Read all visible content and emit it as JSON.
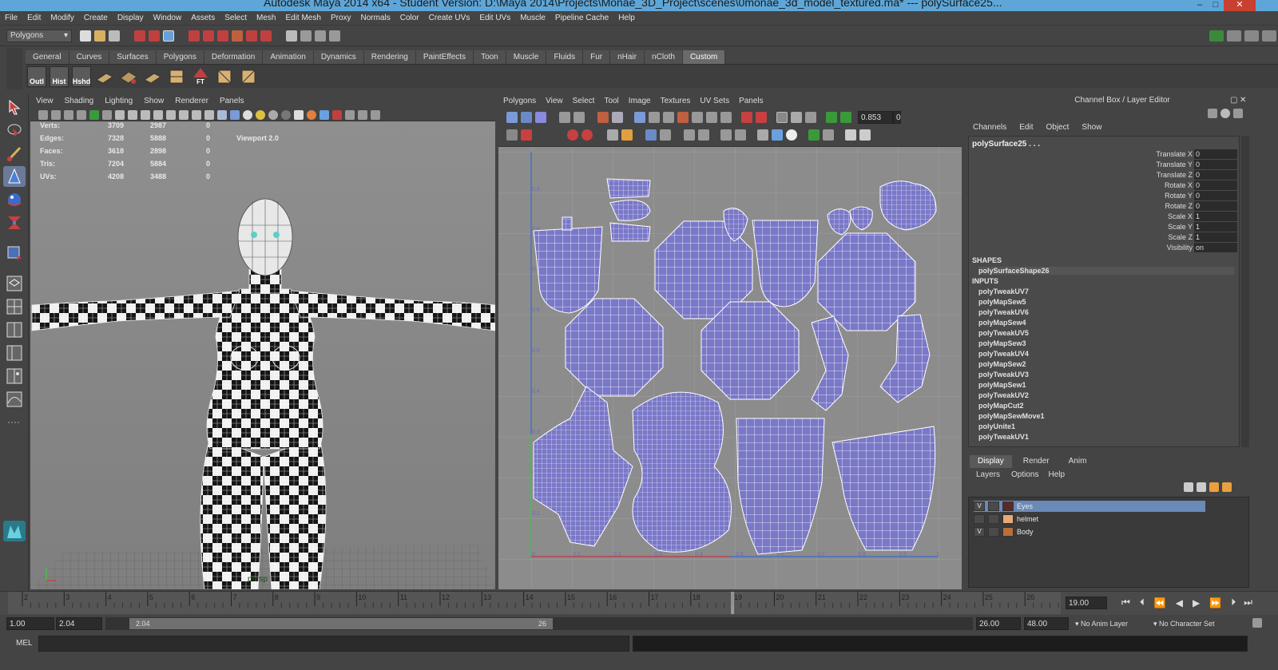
{
  "title": "Autodesk Maya 2014 x64 - Student Version: D:\\Maya 2014\\Projects\\Monae_3D_Project\\scenes\\0monae_3d_model_textured.ma*   ---   polySurface25...",
  "menu": [
    "File",
    "Edit",
    "Modify",
    "Create",
    "Display",
    "Window",
    "Assets",
    "Select",
    "Mesh",
    "Edit Mesh",
    "Proxy",
    "Normals",
    "Color",
    "Create UVs",
    "Edit UVs",
    "Muscle",
    "Pipeline Cache",
    "Help"
  ],
  "mode_selector": "Polygons",
  "shelf_tabs": [
    "General",
    "Curves",
    "Surfaces",
    "Polygons",
    "Deformation",
    "Animation",
    "Dynamics",
    "Rendering",
    "PaintEffects",
    "Toon",
    "Muscle",
    "Fluids",
    "Fur",
    "nHair",
    "nCloth",
    "Custom"
  ],
  "shelf_active": "Custom",
  "shelf_buttons": [
    "Outl",
    "Hist",
    "Hshd"
  ],
  "shelf_ft": "FT",
  "viewport_menu": [
    "View",
    "Shading",
    "Lighting",
    "Show",
    "Renderer",
    "Panels"
  ],
  "hud": {
    "rows": [
      {
        "label": "Verts:",
        "a": "3709",
        "b": "2987",
        "c": "0"
      },
      {
        "label": "Edges:",
        "a": "7328",
        "b": "5888",
        "c": "0"
      },
      {
        "label": "Faces:",
        "a": "3618",
        "b": "2898",
        "c": "0"
      },
      {
        "label": "Tris:",
        "a": "7204",
        "b": "5884",
        "c": "0"
      },
      {
        "label": "UVs:",
        "a": "4208",
        "b": "3488",
        "c": "0"
      }
    ],
    "renderer": "Viewport 2.0",
    "camera": "persp"
  },
  "uv_menu": [
    "Polygons",
    "View",
    "Select",
    "Tool",
    "Image",
    "Textures",
    "UV Sets",
    "Panels"
  ],
  "uv_field": "0.853",
  "uv_field2": "0",
  "uv_axis_labels": {
    "y": [
      "0.9",
      "0.8",
      "0.7",
      "0.6",
      "0.5",
      "0.4",
      "0.3",
      "0.2",
      "0.1"
    ],
    "x": [
      "0",
      "0.1",
      "0.2",
      "0.3",
      "0.4",
      "0.5",
      "0.6",
      "0.7",
      "0.8",
      "0.9",
      "1"
    ]
  },
  "channel_box": {
    "title": "Channel Box / Layer Editor",
    "menu": [
      "Channels",
      "Edit",
      "Object",
      "Show"
    ],
    "object": "polySurface25 . . .",
    "attrs": [
      {
        "name": "Translate X",
        "value": "0"
      },
      {
        "name": "Translate Y",
        "value": "0"
      },
      {
        "name": "Translate Z",
        "value": "0"
      },
      {
        "name": "Rotate X",
        "value": "0"
      },
      {
        "name": "Rotate Y",
        "value": "0"
      },
      {
        "name": "Rotate Z",
        "value": "0"
      },
      {
        "name": "Scale X",
        "value": "1"
      },
      {
        "name": "Scale Y",
        "value": "1"
      },
      {
        "name": "Scale Z",
        "value": "1"
      },
      {
        "name": "Visibility",
        "value": "on"
      }
    ],
    "shapes_label": "SHAPES",
    "shape": "polySurfaceShape26",
    "inputs_label": "INPUTS",
    "inputs": [
      "polyTweakUV7",
      "polyMapSew5",
      "polyTweakUV6",
      "polyMapSew4",
      "polyTweakUV5",
      "polyMapSew3",
      "polyTweakUV4",
      "polyMapSew2",
      "polyTweakUV3",
      "polyMapSew1",
      "polyTweakUV2",
      "polyMapCut2",
      "polyMapSewMove1",
      "polyUnite1",
      "polyTweakUV1"
    ]
  },
  "layer_editor": {
    "tabs": [
      "Display",
      "Render",
      "Anim"
    ],
    "active_tab": "Display",
    "menu": [
      "Layers",
      "Options",
      "Help"
    ],
    "layers": [
      {
        "vis": "V",
        "name": "Eyes",
        "color": "#5a2a2a",
        "selected": true
      },
      {
        "vis": "",
        "name": "helmet",
        "color": "#e8a878",
        "selected": false
      },
      {
        "vis": "V",
        "name": "Body",
        "color": "#b87038",
        "selected": false
      }
    ]
  },
  "timeline": {
    "ticks": [
      "2",
      "3",
      "4",
      "5",
      "6",
      "7",
      "8",
      "9",
      "10",
      "11",
      "12",
      "13",
      "14",
      "15",
      "16",
      "17",
      "18",
      "19",
      "20",
      "21",
      "22",
      "23",
      "24",
      "25",
      "26"
    ],
    "current": "19.00"
  },
  "range": {
    "start": "1.00",
    "current_start": "2.04",
    "slider_start": "2.04",
    "slider_end": "26",
    "end": "26.00",
    "max": "48.00",
    "anim_layer": "No Anim Layer",
    "char_set": "No Character Set"
  },
  "cmd_label": "MEL"
}
